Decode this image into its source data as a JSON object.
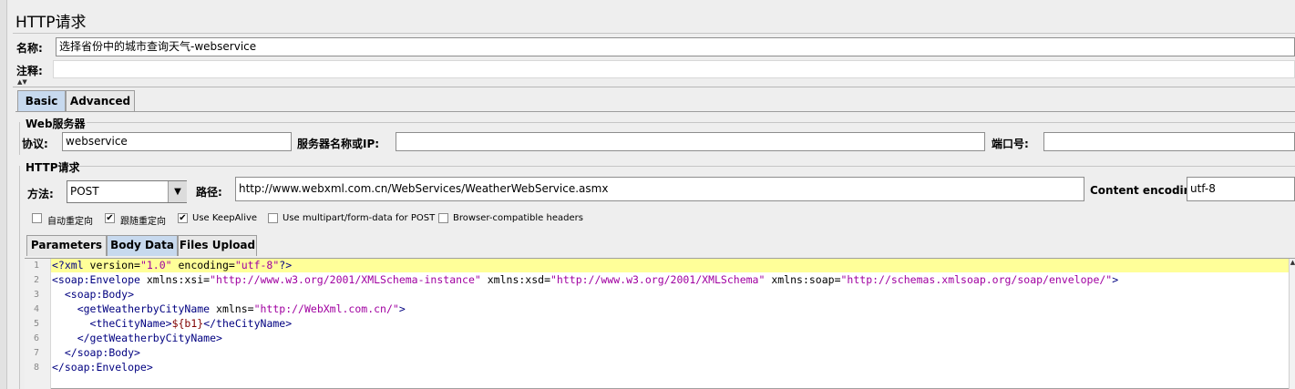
{
  "panel": {
    "title": "HTTP请求"
  },
  "name_row": {
    "label": "名称:",
    "value": "选择省份中的城市查询天气-webservice"
  },
  "comment_row": {
    "label": "注释:",
    "value": ""
  },
  "collapse_glyph": "▲▼",
  "top_tabs": [
    {
      "label": "Basic",
      "selected": true
    },
    {
      "label": "Advanced",
      "selected": false
    }
  ],
  "web_server": {
    "group_title": "Web服务器",
    "protocol_label": "协议:",
    "protocol_value": "webservice",
    "server_label": "服务器名称或IP:",
    "server_value": "",
    "port_label": "端口号:",
    "port_value": ""
  },
  "http_request": {
    "group_title": "HTTP请求",
    "method_label": "方法:",
    "method_value": "POST",
    "path_label": "路径:",
    "path_value": "http://www.webxml.com.cn/WebServices/WeatherWebService.asmx",
    "encoding_label": "Content encoding:",
    "encoding_value": "utf-8"
  },
  "options": [
    {
      "label": "自动重定向",
      "checked": false
    },
    {
      "label": "跟随重定向",
      "checked": true
    },
    {
      "label": "Use KeepAlive",
      "checked": true
    },
    {
      "label": "Use multipart/form-data for POST",
      "checked": false
    },
    {
      "label": "Browser-compatible headers",
      "checked": false
    }
  ],
  "body_tabs": [
    {
      "label": "Parameters",
      "selected": false
    },
    {
      "label": "Body Data",
      "selected": true
    },
    {
      "label": "Files Upload",
      "selected": false
    }
  ],
  "editor": {
    "line_numbers": [
      "1",
      "2",
      "3",
      "4",
      "5",
      "6",
      "7",
      "8"
    ],
    "lines": [
      "<?xml version=\"1.0\" encoding=\"utf-8\"?>",
      "<soap:Envelope xmlns:xsi=\"http://www.w3.org/2001/XMLSchema-instance\" xmlns:xsd=\"http://www.w3.org/2001/XMLSchema\" xmlns:soap=\"http://schemas.xmlsoap.org/soap/envelope/\">",
      "  <soap:Body>",
      "    <getWeatherbyCityName xmlns=\"http://WebXml.com.cn/\">",
      "      <theCityName>${b1}</theCityName>",
      "    </getWeatherbyCityName>",
      "  </soap:Body>",
      "</soap:Envelope>"
    ],
    "highlight_color": "#ffff99"
  },
  "colors": {
    "tab_selected": "#c7d9ee",
    "background": "#eeeeee"
  },
  "icons": {
    "dropdown": "triangle-down-icon",
    "check": "check-icon",
    "scroll_up": "triangle-up-icon"
  }
}
